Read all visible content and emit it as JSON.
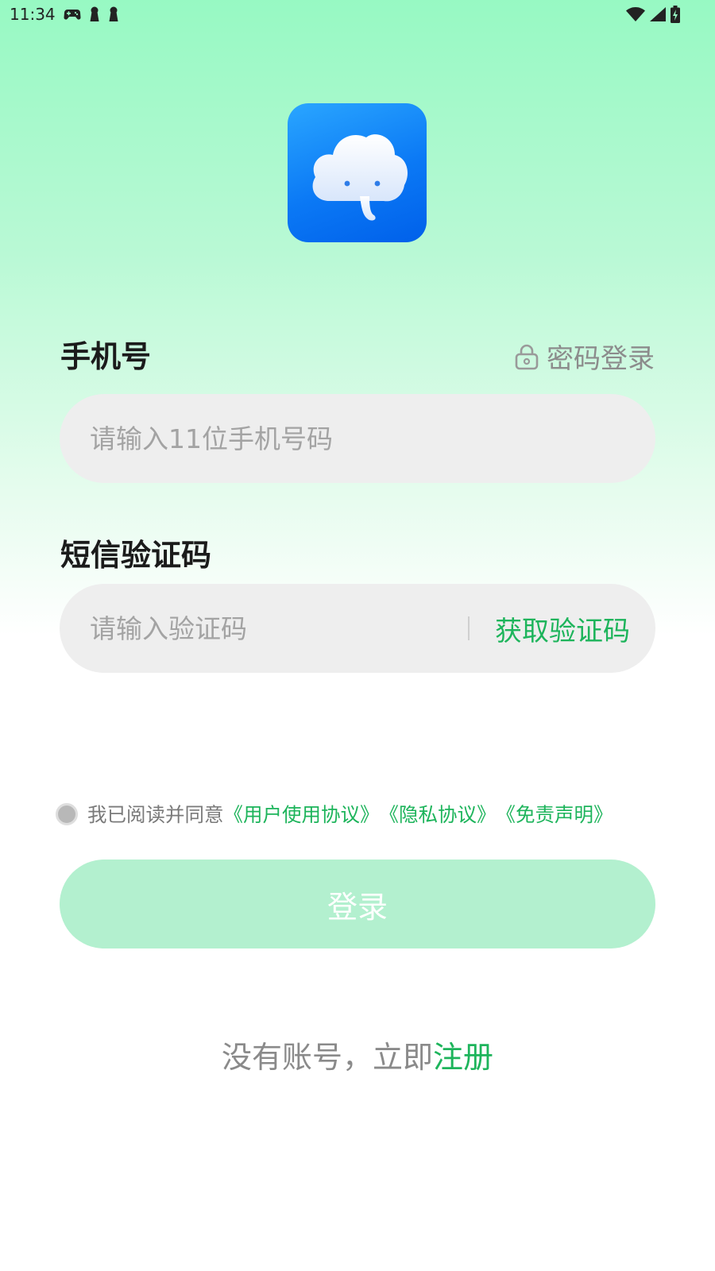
{
  "status_bar": {
    "time": "11:34",
    "icons_left": [
      "gamepad-icon",
      "keyhole-icon",
      "keyhole-icon"
    ],
    "icons_right": [
      "wifi-icon",
      "signal-icon",
      "battery-charging-icon"
    ]
  },
  "app": {
    "logo_icon": "elephant-cloud-logo"
  },
  "phone": {
    "label": "手机号",
    "password_login": "密码登录",
    "password_login_icon": "lock-icon",
    "placeholder": "请输入11位手机号码",
    "value": ""
  },
  "sms": {
    "label": "短信验证码",
    "placeholder": "请输入验证码",
    "value": "",
    "get_code": "获取验证码"
  },
  "agreement": {
    "checked": false,
    "prefix": "我已阅读并同意",
    "links": [
      "《用户使用协议》",
      "《隐私协议》",
      "《免责声明》"
    ]
  },
  "login_button": {
    "label": "登录",
    "enabled": false
  },
  "register": {
    "prefix": "没有账号，立即",
    "link": "注册"
  },
  "colors": {
    "accent": "#1db45b",
    "button_disabled": "#b3f0cf",
    "field_bg": "#eeeeee",
    "logo_blue": "#0b79f5"
  }
}
